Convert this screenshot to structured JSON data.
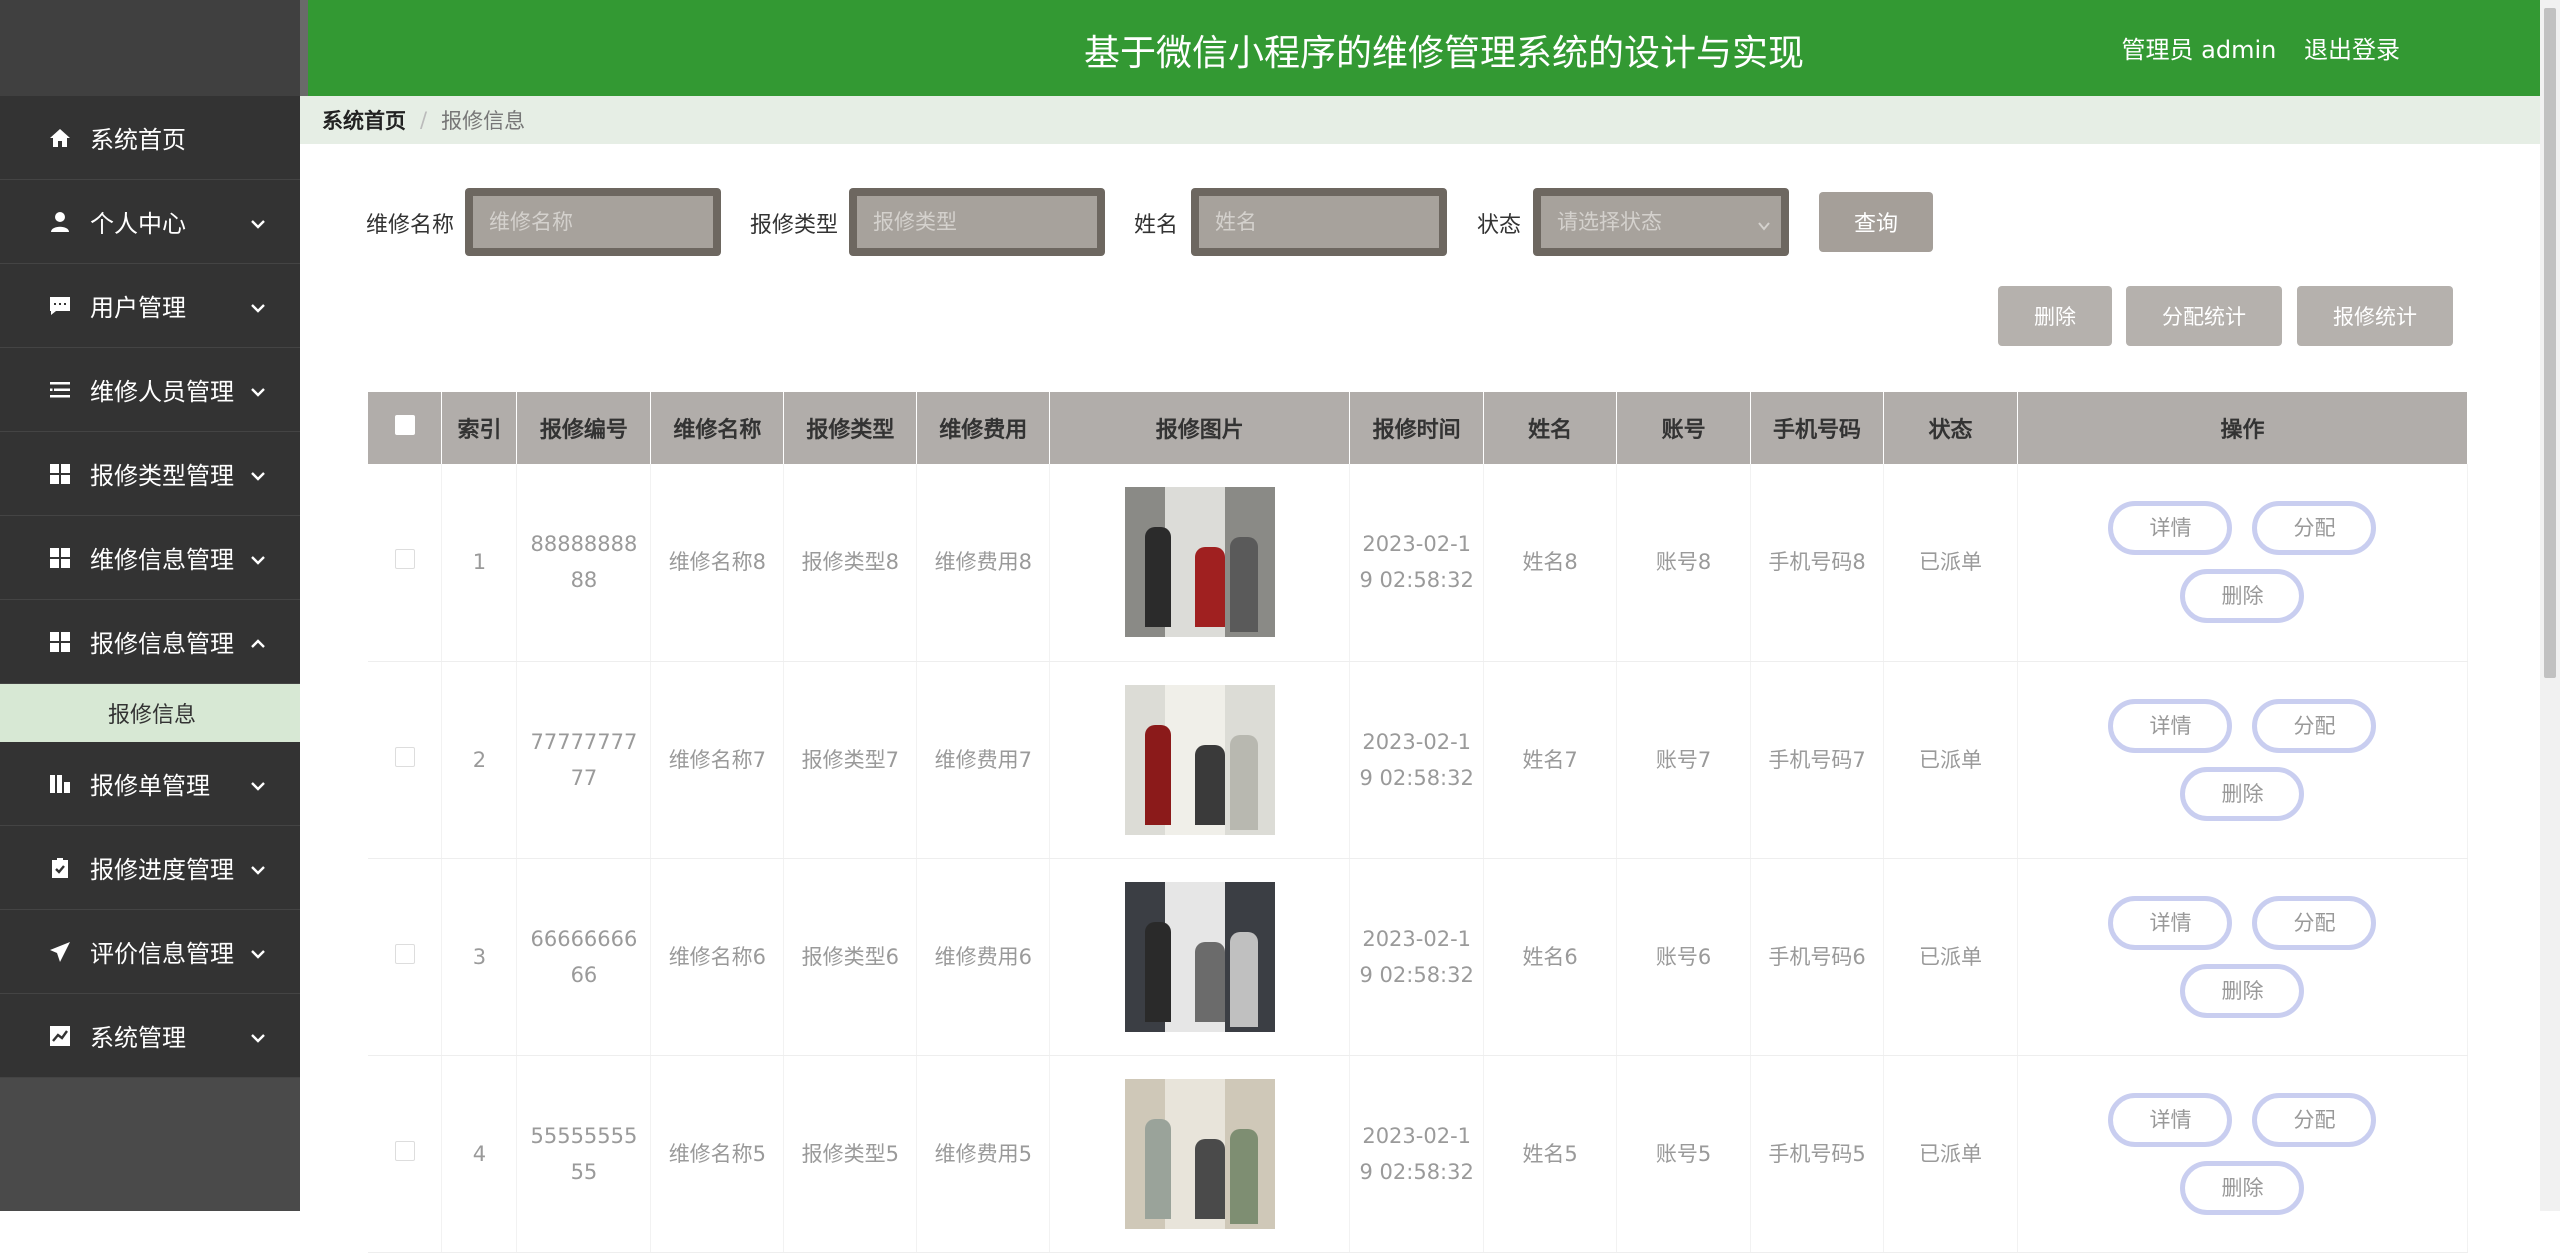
{
  "header": {
    "title": "基于微信小程序的维修管理系统的设计与实现",
    "user_label": "管理员 admin",
    "logout_label": "退出登录"
  },
  "breadcrumb": {
    "home": "系统首页",
    "separator": "/",
    "current": "报修信息"
  },
  "sidebar": {
    "items": [
      {
        "label": "系统首页",
        "icon": "home-icon",
        "chevron": ""
      },
      {
        "label": "个人中心",
        "icon": "user-icon",
        "chevron": "down"
      },
      {
        "label": "用户管理",
        "icon": "chat-icon",
        "chevron": "down"
      },
      {
        "label": "维修人员管理",
        "icon": "list-icon",
        "chevron": "down"
      },
      {
        "label": "报修类型管理",
        "icon": "grid-icon",
        "chevron": "down"
      },
      {
        "label": "维修信息管理",
        "icon": "grid-icon",
        "chevron": "down"
      },
      {
        "label": "报修信息管理",
        "icon": "grid-icon",
        "chevron": "up"
      },
      {
        "label": "报修单管理",
        "icon": "chart-bar-icon",
        "chevron": "down"
      },
      {
        "label": "报修进度管理",
        "icon": "clipboard-icon",
        "chevron": "down"
      },
      {
        "label": "评价信息管理",
        "icon": "send-icon",
        "chevron": "down"
      },
      {
        "label": "系统管理",
        "icon": "trend-icon",
        "chevron": "down"
      }
    ],
    "sub_item": "报修信息"
  },
  "search": {
    "name_label": "维修名称",
    "name_placeholder": "维修名称",
    "type_label": "报修类型",
    "type_placeholder": "报修类型",
    "person_label": "姓名",
    "person_placeholder": "姓名",
    "status_label": "状态",
    "status_placeholder": "请选择状态",
    "query_button": "查询"
  },
  "actions": {
    "delete": "删除",
    "assign_stats": "分配统计",
    "repair_stats": "报修统计"
  },
  "table": {
    "columns": [
      "索引",
      "报修编号",
      "维修名称",
      "报修类型",
      "维修费用",
      "报修图片",
      "报修时间",
      "姓名",
      "账号",
      "手机号码",
      "状态",
      "操作"
    ],
    "rows": [
      {
        "index": "1",
        "code": "8888888888",
        "name": "维修名称8",
        "type": "报修类型8",
        "fee": "维修费用8",
        "time": "2023-02-19 02:58:32",
        "person": "姓名8",
        "account": "账号8",
        "phone": "手机号码8",
        "status": "已派单"
      },
      {
        "index": "2",
        "code": "7777777777",
        "name": "维修名称7",
        "type": "报修类型7",
        "fee": "维修费用7",
        "time": "2023-02-19 02:58:32",
        "person": "姓名7",
        "account": "账号7",
        "phone": "手机号码7",
        "status": "已派单"
      },
      {
        "index": "3",
        "code": "6666666666",
        "name": "维修名称6",
        "type": "报修类型6",
        "fee": "维修费用6",
        "time": "2023-02-19 02:58:32",
        "person": "姓名6",
        "account": "账号6",
        "phone": "手机号码6",
        "status": "已派单"
      },
      {
        "index": "4",
        "code": "5555555555",
        "name": "维修名称5",
        "type": "报修类型5",
        "fee": "维修费用5",
        "time": "2023-02-19 02:58:32",
        "person": "姓名5",
        "account": "账号5",
        "phone": "手机号码5",
        "status": "已派单"
      }
    ],
    "op_labels": {
      "detail": "详情",
      "assign": "分配",
      "delete": "删除"
    }
  },
  "colors": {
    "header": "#339933",
    "sidebar": "#333333",
    "active_sub": "#d7e8d4",
    "table_head": "#b1adaa"
  }
}
